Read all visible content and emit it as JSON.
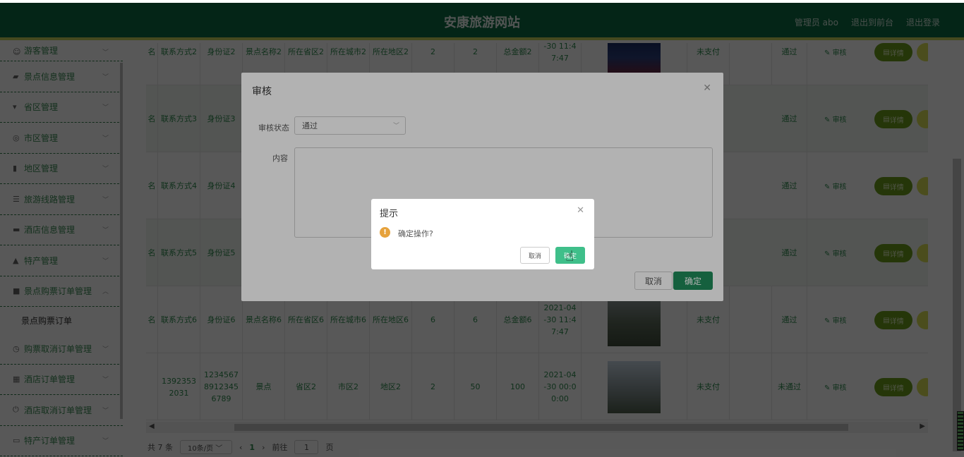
{
  "header": {
    "title": "安康旅游网站",
    "user": "管理员 abo",
    "to_front": "退出到前台",
    "logout": "退出登录"
  },
  "sidebar": {
    "items": [
      {
        "label": "游客管理",
        "icon": "user-group-icon"
      },
      {
        "label": "景点信息管理",
        "icon": "ticket-icon"
      },
      {
        "label": "省区管理",
        "icon": "flag-icon"
      },
      {
        "label": "市区管理",
        "icon": "circle-icon"
      },
      {
        "label": "地区管理",
        "icon": "bar-chart-icon"
      },
      {
        "label": "旅游线路管理",
        "icon": "list-icon"
      },
      {
        "label": "酒店信息管理",
        "icon": "monitor-icon"
      },
      {
        "label": "特产管理",
        "icon": "person-icon"
      },
      {
        "label": "景点购票订单管理",
        "icon": "briefcase-icon"
      },
      {
        "label": "购票取消订单管理",
        "icon": "clock-icon"
      },
      {
        "label": "酒店订单管理",
        "icon": "grid-icon"
      },
      {
        "label": "酒店取消订单管理",
        "icon": "power-icon"
      },
      {
        "label": "特产订单管理",
        "icon": "chat-icon"
      }
    ],
    "sub_item": "景点购票订单"
  },
  "table": {
    "rows": [
      {
        "name_tail": "名",
        "contact": "联系方式2",
        "idcard": "身份证2",
        "scenic": "景点名称2",
        "province": "所在省区2",
        "city": "所在城市2",
        "area": "所在地区2",
        "price": "2",
        "qty": "2",
        "total": "总金额2",
        "time": "-30 11:4 7:47",
        "status": "未支付",
        "audit": "通过",
        "audit_link": "审核",
        "detail": "详情"
      },
      {
        "name_tail": "名",
        "contact": "联系方式3",
        "idcard": "身份证3",
        "scenic": "",
        "province": "",
        "city": "",
        "area": "",
        "price": "",
        "qty": "",
        "total": "",
        "time": "",
        "status": "",
        "audit": "通过",
        "audit_link": "审核",
        "detail": "详情"
      },
      {
        "name_tail": "名",
        "contact": "联系方式4",
        "idcard": "身份证4",
        "scenic": "",
        "province": "",
        "city": "",
        "area": "",
        "price": "",
        "qty": "",
        "total": "",
        "time": "",
        "status": "",
        "audit": "通过",
        "audit_link": "审核",
        "detail": "详情"
      },
      {
        "name_tail": "名",
        "contact": "联系方式5",
        "idcard": "身份证5",
        "scenic": "",
        "province": "",
        "city": "",
        "area": "",
        "price": "",
        "qty": "",
        "total": "",
        "time": "",
        "status": "",
        "audit": "通过",
        "audit_link": "审核",
        "detail": "详情"
      },
      {
        "name_tail": "名",
        "contact": "联系方式6",
        "idcard": "身份证6",
        "scenic": "景点名称6",
        "province": "所在省区6",
        "city": "所在城市6",
        "area": "所在地区6",
        "price": "6",
        "qty": "6",
        "total": "总金额6",
        "time": "2021-04 -30 11:4 7:47",
        "status": "未支付",
        "audit": "通过",
        "audit_link": "审核",
        "detail": "详情"
      },
      {
        "name_tail": "",
        "contact": "13923532031",
        "idcard": "123456789123456789",
        "scenic": "景点",
        "province": "省区2",
        "city": "市区2",
        "area": "地区2",
        "price": "2",
        "qty": "50",
        "total": "100",
        "time": "2021-04 -30 00:0 0:00",
        "status": "未支付",
        "audit": "未通过",
        "audit_link": "审核",
        "detail": "详情"
      }
    ]
  },
  "pager": {
    "total": "共 7 条",
    "page_size": "10条/页",
    "prev": "‹",
    "current": "1",
    "next": "›",
    "goto": "前往",
    "goto_value": "1",
    "page_unit": "页"
  },
  "audit_dialog": {
    "title": "审核",
    "status_label": "审核状态",
    "status_value": "通过",
    "content_label": "内容",
    "cancel": "取消",
    "ok": "确定"
  },
  "confirm_box": {
    "title": "提示",
    "message": "确定操作?",
    "cancel": "取消",
    "ok": "确定"
  }
}
